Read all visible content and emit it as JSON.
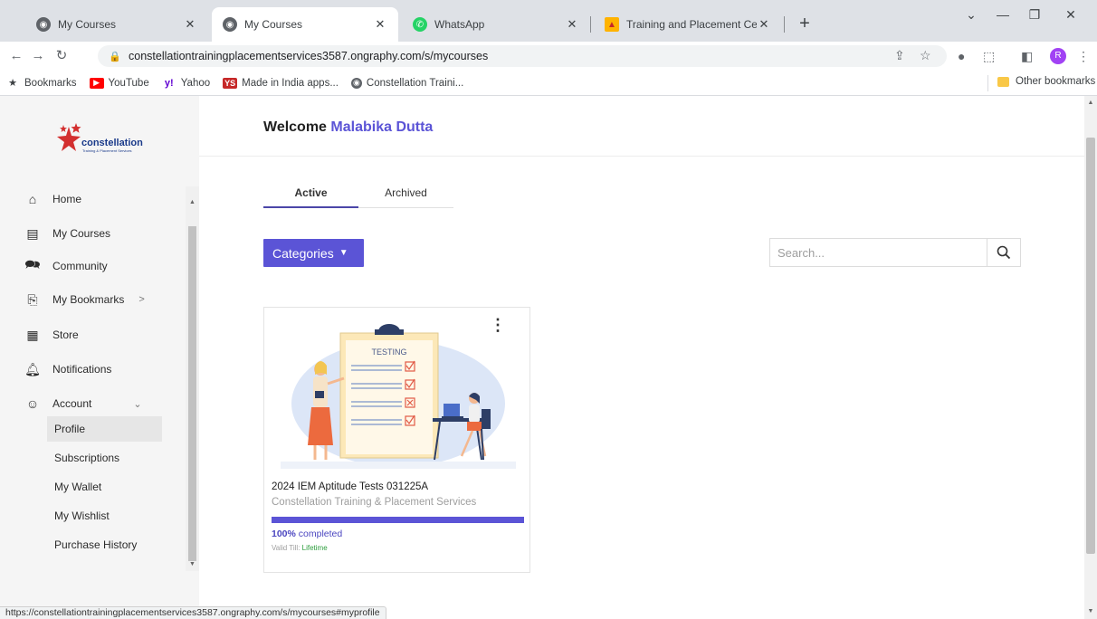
{
  "browser": {
    "tabs": [
      {
        "title": "My Courses",
        "favicon": "globe-icon",
        "active": false
      },
      {
        "title": "My Courses",
        "favicon": "globe-icon",
        "active": true
      },
      {
        "title": "WhatsApp",
        "favicon": "whatsapp-icon",
        "active": false
      },
      {
        "title": "Training and Placement Cell",
        "favicon": "site-icon",
        "active": false
      }
    ],
    "close_glyph": "✕",
    "new_tab_glyph": "+",
    "url": "constellationtrainingplacementservices3587.ongraphy.com/s/mycourses",
    "profile_initial": "R",
    "bookmarks": [
      {
        "label": "Bookmarks",
        "icon": "star-icon"
      },
      {
        "label": "YouTube",
        "icon": "youtube-icon"
      },
      {
        "label": "Yahoo",
        "icon": "yahoo-icon"
      },
      {
        "label": "Made in India apps...",
        "icon": "ys-icon"
      },
      {
        "label": "Constellation Traini...",
        "icon": "globe-icon"
      }
    ],
    "other_bookmarks": "Other bookmarks",
    "status_url": "https://constellationtrainingplacementservices3587.ongraphy.com/s/mycourses#myprofile"
  },
  "sidebar": {
    "logo_text": "constellation",
    "logo_subtext": "Training & Placement Services",
    "items": [
      {
        "label": "Home",
        "icon": "home-icon"
      },
      {
        "label": "My Courses",
        "icon": "courses-icon"
      },
      {
        "label": "Community",
        "icon": "community-icon"
      },
      {
        "label": "My Bookmarks",
        "icon": "bookmark-icon",
        "chevron": ">"
      },
      {
        "label": "Store",
        "icon": "store-icon"
      },
      {
        "label": "Notifications",
        "icon": "bell-icon"
      },
      {
        "label": "Account",
        "icon": "account-icon",
        "chevron": "⌄"
      }
    ],
    "account_sub": [
      "Profile",
      "Subscriptions",
      "My Wallet",
      "My Wishlist",
      "Purchase History"
    ],
    "selected_sub": "Profile"
  },
  "main": {
    "welcome_prefix": "Welcome",
    "user_name": "Malabika Dutta",
    "tabs": [
      "Active",
      "Archived"
    ],
    "active_tab": "Active",
    "categories_label": "Categories",
    "search_placeholder": "Search..."
  },
  "course": {
    "illustration_label": "TESTING",
    "title": "2024 IEM Aptitude Tests 031225A",
    "org": "Constellation Training & Placement Services",
    "progress_percent": 100,
    "progress_value": "100%",
    "progress_suffix": " completed",
    "valid_prefix": "Valid Till: ",
    "valid_value": "Lifetime"
  },
  "colors": {
    "accent": "#5b54d6",
    "valid_green": "#2e9e3e"
  }
}
